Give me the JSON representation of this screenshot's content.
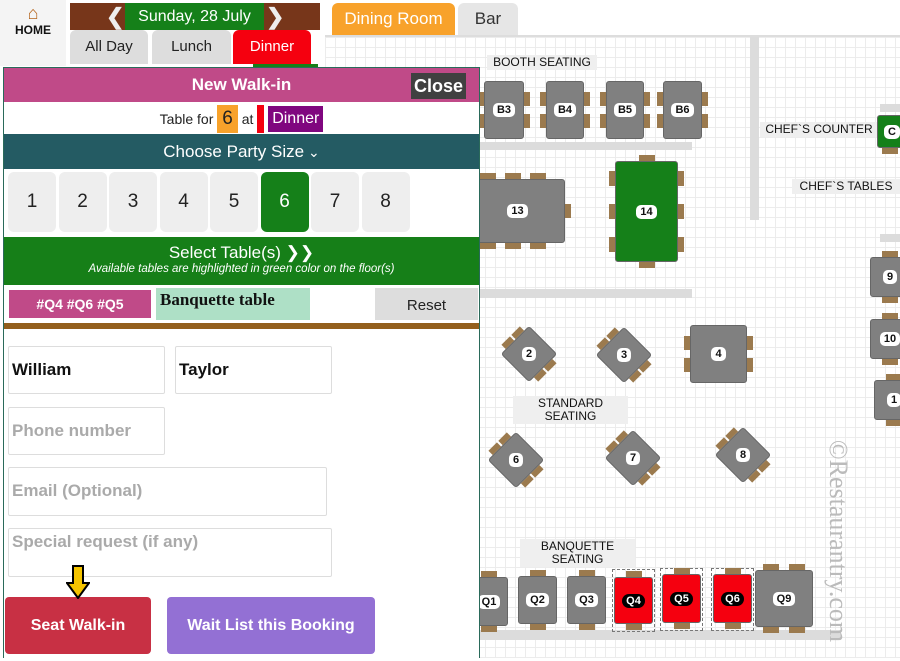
{
  "nav": {
    "home_label": "HOME",
    "home_icon": "house-icon"
  },
  "date": {
    "label": "Sunday, 28 July",
    "prev_icon": "chevron-left-icon",
    "next_icon": "chevron-right-icon"
  },
  "meal_tabs": [
    {
      "label": "All Day"
    },
    {
      "label": "Lunch"
    },
    {
      "label": "Dinner",
      "active": true
    }
  ],
  "floor_tabs": [
    {
      "label": "Dining Room",
      "active": true
    },
    {
      "label": "Bar"
    }
  ],
  "floor": {
    "labels": {
      "booth": "BOOTH SEATING",
      "chefs_counter": "CHEF`S COUNTER",
      "chefs_tables": "CHEF`S TABLES",
      "standard": "STANDARD SEATING",
      "banquette": "BANQUETTE SEATING"
    },
    "tables": [
      {
        "label": "B3",
        "status": "free"
      },
      {
        "label": "B4",
        "status": "free"
      },
      {
        "label": "B5",
        "status": "free"
      },
      {
        "label": "B6",
        "status": "free"
      },
      {
        "label": "13",
        "status": "free"
      },
      {
        "label": "14",
        "status": "available"
      },
      {
        "label": "C",
        "status": "available"
      },
      {
        "label": "9",
        "status": "free"
      },
      {
        "label": "10",
        "status": "free"
      },
      {
        "label": "1",
        "status": "free"
      },
      {
        "label": "2",
        "status": "free"
      },
      {
        "label": "3",
        "status": "free"
      },
      {
        "label": "4",
        "status": "free"
      },
      {
        "label": "6",
        "status": "free"
      },
      {
        "label": "7",
        "status": "free"
      },
      {
        "label": "8",
        "status": "free"
      },
      {
        "label": "Q1",
        "status": "free"
      },
      {
        "label": "Q2",
        "status": "free"
      },
      {
        "label": "Q3",
        "status": "free"
      },
      {
        "label": "Q4",
        "status": "selected"
      },
      {
        "label": "Q5",
        "status": "selected"
      },
      {
        "label": "Q6",
        "status": "selected"
      },
      {
        "label": "Q9",
        "status": "free"
      }
    ],
    "watermark": "©Restaurantry.com"
  },
  "colors": {
    "available": "#158019",
    "selected": "#f5000f",
    "free": "#808080",
    "header": "#c04a88",
    "accent_teal": "#245b63"
  },
  "modal": {
    "title": "New Walk-in",
    "close_label": "Close",
    "table_for_label": "Table for",
    "party_size": "6",
    "at_label": "at",
    "meal": "Dinner",
    "choose_party_label": "Choose Party Size",
    "party_sizes": [
      "1",
      "2",
      "3",
      "4",
      "5",
      "6",
      "7",
      "8"
    ],
    "selected_party_size": "6",
    "select_tables_label": "Select Table(s) ❯❯",
    "select_tables_hint": "Available tables are highlighted in green color on the floor(s)",
    "selected_tables": "#Q4 #Q6 #Q5",
    "table_type": "Banquette table",
    "reset_label": "Reset",
    "first_name": "William",
    "last_name": "Taylor",
    "phone_placeholder": "Phone number",
    "email_placeholder": "Email (Optional)",
    "request_placeholder": "Special request (if any)",
    "seat_label": "Seat Walk-in",
    "waitlist_label": "Wait List this Booking"
  }
}
